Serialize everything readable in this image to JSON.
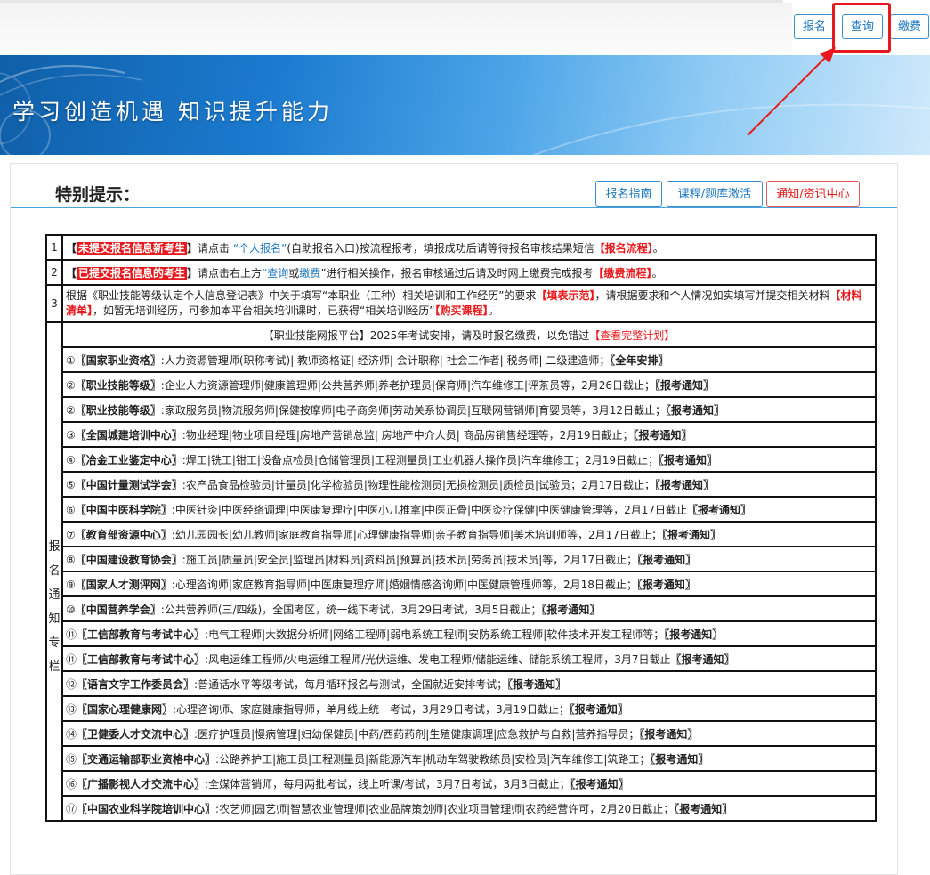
{
  "header": {
    "buttons": {
      "register": "报名",
      "query": "查询",
      "pay": "缴费"
    }
  },
  "banner": {
    "slogan": "学习创造机遇  知识提升能力"
  },
  "notice": {
    "title": "特别提示：",
    "buttons": {
      "guide": "报名指南",
      "course": "课程/题库激活",
      "news": "通知/资讯中心"
    }
  },
  "rows": [
    {
      "num": "1",
      "open": "【",
      "highlight": "未提交报名信息新考生",
      "close": "】",
      "text1": "请点击",
      "link": "“个人报名”",
      "text2": "(自助报名入口)按流程报考，填报成功后请等待报名审核结果短信",
      "tag": "【报名流程】",
      "end": "。"
    },
    {
      "num": "2",
      "open": "【",
      "highlight": "已提交报名信息的考生",
      "close": "】",
      "text1": "请点击右上方",
      "link1": "“查询",
      "or": "或",
      "link2": "缴费",
      "text2": "”进行相关操作，报名审核通过后请及时网上缴费完成报考",
      "tag": "【缴费流程】",
      "end": "。"
    },
    {
      "num": "3",
      "text1": "根据《职业技能等级认定个人信息登记表》中关于填写“本职业（工种）相关培训和工作经历”的要求",
      "tag1": "【填表示范】",
      "text2": "，请根据要求和个人情况如实填写并提交相关材料",
      "tag2": "【材料清单】",
      "text3": "，如暂无培训经历，可参加本平台相关培训课时，已获得“相关培训经历”",
      "tag3": "【购买课程】",
      "end": "。"
    }
  ],
  "schedule": {
    "side_label": [
      "报",
      "名",
      "通",
      "知",
      "专",
      "栏"
    ],
    "header": "【职业技能网报平台】2025年考试安排，请及时报名缴费，以免错过",
    "header_link": "【查看完整计划】",
    "items": [
      {
        "idx": "①",
        "org": "〖国家职业资格〗",
        "desc": ":人力资源管理师(职称考试)| 教师资格证| 经济师| 会计职称| 社会工作者| 税务师| 二级建造师；",
        "notice": "〖全年安排〗"
      },
      {
        "idx": "②",
        "org": "〖职业技能等级〗",
        "desc": ":企业人力资源管理师|健康管理师|公共营养师|养老护理员|保育师|汽车维修工|评茶员等，2月26日截止；",
        "notice": "〖报考通知〗"
      },
      {
        "idx": "②",
        "org": "〖职业技能等级〗",
        "desc": ":家政服务员|物流服务师|保健按摩师|电子商务师|劳动关系协调员|互联网营销师|育婴员等，3月12日截止；",
        "notice": "〖报考通知〗"
      },
      {
        "idx": "③",
        "org": "〖全国城建培训中心〗",
        "desc": ":物业经理|物业项目经理|房地产营销总监| 房地产中介人员| 商品房销售经理等，2月19日截止；",
        "notice": "〖报考通知〗"
      },
      {
        "idx": "④",
        "org": "〖冶金工业鉴定中心〗",
        "desc": ":焊工|铣工|钳工|设备点检员|仓储管理员|工程测量员|工业机器人操作员|汽车维修工；2月19日截止；",
        "notice": "〖报考通知〗"
      },
      {
        "idx": "⑤",
        "org": "〖中国计量测试学会〗",
        "desc": ":农产品食品检验员|计量员|化学检验员|物理性能检测员|无损检测员|质检员|试验员；2月17日截止；",
        "notice": "〖报考通知〗"
      },
      {
        "idx": "⑥",
        "org": "〖中国中医科学院〗",
        "desc": ":中医针灸|中医经络调理|中医康复理疗|中医小儿推拿|中医正骨|中医灸疗保健|中医健康管理等，2月17日截止",
        "notice": "〖报考通知〗"
      },
      {
        "idx": "⑦",
        "org": "〖教育部资源中心〗",
        "desc": ":幼儿园园长|幼儿教师|家庭教育指导师|心理健康指导师|亲子教育指导师|美术培训师等，2月17日截止；",
        "notice": "〖报考通知〗"
      },
      {
        "idx": "⑧",
        "org": "〖中国建设教育协会〗",
        "desc": ":施工员|质量员|安全员|监理员|材料员|资料员|预算员|技术员|劳务员|技术员|等，2月17日截止；",
        "notice": "〖报考通知〗"
      },
      {
        "idx": "⑨",
        "org": "〖国家人才测评网〗",
        "desc": ":心理咨询师|家庭教育指导师|中医康复理疗师|婚姻情感咨询师|中医健康管理师等，2月18日截止；",
        "notice": "〖报考通知〗"
      },
      {
        "idx": "⑩",
        "org": "〖中国营养学会〗",
        "desc": ":公共营养师(三/四级)，全国考区，统一线下考试，3月29日考试，3月5日截止；",
        "notice": "〖报考通知〗"
      },
      {
        "idx": "⑪",
        "org": "〖工信部教育与考试中心〗",
        "desc": ":电气工程师|大数据分析师|网络工程师|弱电系统工程师|安防系统工程师|软件技术开发工程师等；",
        "notice": "〖报考通知〗"
      },
      {
        "idx": "⑪",
        "org": "〖工信部教育与考试中心〗",
        "desc": ":风电运维工程师/火电运维工程师/光伏运维、发电工程师/储能运维、储能系统工程师，3月7日截止",
        "notice": "〖报考通知〗"
      },
      {
        "idx": "⑫",
        "org": "〖语言文字工作委员会〗",
        "desc": ":普通话水平等级考试，每月循环报名与测试，全国就近安排考试；",
        "notice": "〖报考通知〗"
      },
      {
        "idx": "⑬",
        "org": "〖国家心理健康网〗",
        "desc": ":心理咨询师、家庭健康指导师，单月线上统一考试，3月29日考试，3月19日截止；",
        "notice": "〖报考通知〗"
      },
      {
        "idx": "⑭",
        "org": "〖卫健委人才交流中心〗",
        "desc": ":医疗护理员|慢病管理|妇幼保健员|中药/西药药剂|生殖健康调理|应急救护与自救|营养指导员；",
        "notice": "〖报考通知〗"
      },
      {
        "idx": "⑮",
        "org": "〖交通运输部职业资格中心〗",
        "desc": ":公路养护工|施工员|工程测量员|新能源汽车|机动车驾驶教练员|安检员|汽车维修工|筑路工；",
        "notice": "〖报考通知〗"
      },
      {
        "idx": "⑯",
        "org": "〖广播影视人才交流中心〗",
        "desc": ":全媒体营销师，每月两批考试，线上听课/考试，3月7日考试，3月3日截止；",
        "notice": "〖报考通知〗"
      },
      {
        "idx": "⑰",
        "org": "〖中国农业科学院培训中心〗",
        "desc": ":农艺师|园艺师|智慧农业管理师|农业品牌策划师|农业项目管理师|农药经营许可，2月20日截止；",
        "notice": "〖报考通知〗"
      }
    ]
  }
}
